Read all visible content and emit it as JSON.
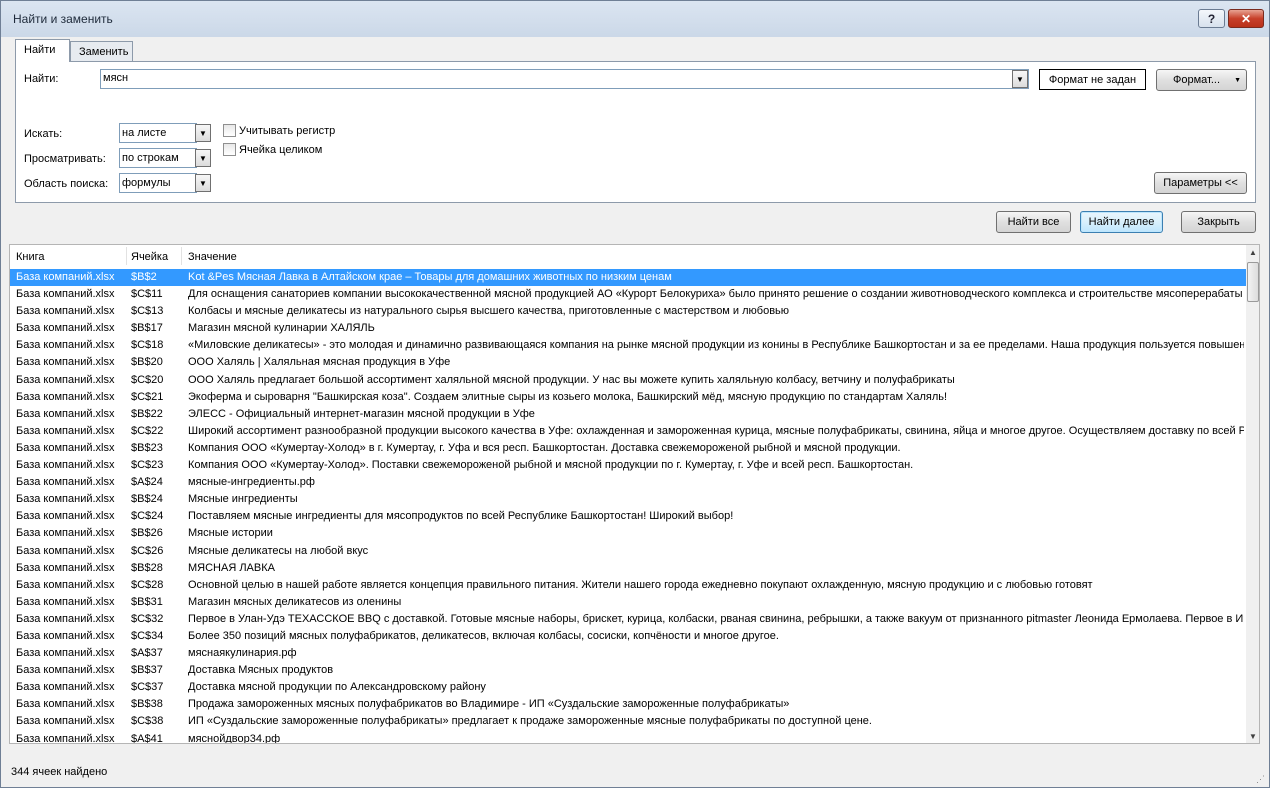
{
  "window": {
    "title": "Найти и заменить",
    "help": "?",
    "close": "✕"
  },
  "tabs": [
    {
      "label": "Найти"
    },
    {
      "label": "Заменить"
    }
  ],
  "find": {
    "label": "Найти:",
    "value": "мясн",
    "format_status": "Формат не задан",
    "format_button": "Формат...",
    "format_dropdown": "▼"
  },
  "options": {
    "within_label": "Искать:",
    "within_value": "на листе",
    "search_label": "Просматривать:",
    "search_value": "по строкам",
    "lookin_label": "Область поиска:",
    "lookin_value": "формулы",
    "match_case": "Учитывать регистр",
    "match_entire": "Ячейка целиком",
    "params_button": "Параметры <<"
  },
  "buttons": {
    "find_all": "Найти все",
    "find_next": "Найти далее",
    "close": "Закрыть"
  },
  "results": {
    "columns": [
      "Книга",
      "Ячейка",
      "Значение"
    ],
    "rows": [
      [
        "База компаний.xlsx",
        "$B$2",
        "Kot &Pes Мясная Лавка в Алтайском крае – Товары для домашних животных по низким ценам"
      ],
      [
        "База компаний.xlsx",
        "$C$11",
        "Для оснащения санаториев компании высококачественной мясной продукцией АО «Курорт Белокуриха» было принято решение о создании животноводческого комплекса и строительстве мясоперерабаты"
      ],
      [
        "База компаний.xlsx",
        "$C$13",
        "Колбасы и мясные деликатесы из натурального сырья высшего качества, приготовленные с мастерством и любовью"
      ],
      [
        "База компаний.xlsx",
        "$B$17",
        "Магазин мясной кулинарии ХАЛЯЛЬ"
      ],
      [
        "База компаний.xlsx",
        "$C$18",
        "«Миловские деликатесы» - это молодая и динамично развивающаяся компания на рынке мясной продукции из конины в Республике Башкортостан и за ее пределами. Наша продукция пользуется повышенн"
      ],
      [
        "База компаний.xlsx",
        "$B$20",
        "ООО Халяль | Халяльная мясная продукция в Уфе"
      ],
      [
        "База компаний.xlsx",
        "$C$20",
        "ООО Халяль предлагает большой ассортимент халяльной мясной продукции. У нас вы можете купить халяльную колбасу, ветчину и полуфабрикаты"
      ],
      [
        "База компаний.xlsx",
        "$C$21",
        "Экоферма и сыроварня \"Башкирская коза\". Создаем элитные сыры из козьего молока, Башкирский мёд, мясную продукцию по стандартам Халяль!"
      ],
      [
        "База компаний.xlsx",
        "$B$22",
        "ЭЛЕСС - Официальный интернет-магазин мясной продукции в Уфе"
      ],
      [
        "База компаний.xlsx",
        "$C$22",
        "Широкий ассортимент разнообразной продукции высокого качества в Уфе: охлажденная и замороженная курица, мясные полуфабрикаты, свинина, яйца и многое другое. Осуществляем доставку по всей Р"
      ],
      [
        "База компаний.xlsx",
        "$B$23",
        "Компания ООО «Кумертау-Холод» в г. Кумертау, г. Уфа и вся респ. Башкортостан. Доставка свежемороженой рыбной и мясной продукции."
      ],
      [
        "База компаний.xlsx",
        "$C$23",
        "Компания ООО «Кумертау-Холод». Поставки свежемороженой рыбной и мясной продукции по г. Кумертау, г. Уфе и всей респ. Башкортостан."
      ],
      [
        "База компаний.xlsx",
        "$A$24",
        "мясные-ингредиенты.рф"
      ],
      [
        "База компаний.xlsx",
        "$B$24",
        "Мясные ингредиенты"
      ],
      [
        "База компаний.xlsx",
        "$C$24",
        "Поставляем мясные ингредиенты для мясопродуктов по всей Республике Башкортостан! Широкий выбор!"
      ],
      [
        "База компаний.xlsx",
        "$B$26",
        "Мясные истории"
      ],
      [
        "База компаний.xlsx",
        "$C$26",
        "Мясные деликатесы на любой вкус"
      ],
      [
        "База компаний.xlsx",
        "$B$28",
        "МЯСНАЯ ЛАВКА"
      ],
      [
        "База компаний.xlsx",
        "$C$28",
        "Основной целью в нашей работе является концепция правильного питания. Жители нашего города ежедневно покупают охлажденную, мясную продукцию и с любовью готовят"
      ],
      [
        "База компаний.xlsx",
        "$B$31",
        "Магазин мясных деликатесов из оленины"
      ],
      [
        "База компаний.xlsx",
        "$C$32",
        "Первое в Улан-Удэ ТЕХАССКОЕ BBQ с доставкой. Готовые мясные наборы, брискет, курица, колбаски, рваная свинина, ребрышки, а также вакуум от признанного pitmaster Леонида Ермолаева. Первое в Ир"
      ],
      [
        "База компаний.xlsx",
        "$C$34",
        "Более 350 позиций мясных полуфабрикатов, деликатесов, включая колбасы, сосиски, копчёности и многое другое."
      ],
      [
        "База компаний.xlsx",
        "$A$37",
        "мяснаякулинария.рф"
      ],
      [
        "База компаний.xlsx",
        "$B$37",
        "Доставка Мясных продуктов"
      ],
      [
        "База компаний.xlsx",
        "$C$37",
        "Доставка мясной продукции по Александровскому району"
      ],
      [
        "База компаний.xlsx",
        "$B$38",
        "Продажа замороженных мясных полуфабрикатов во Владимире - ИП «Суздальские замороженные полуфабрикаты»"
      ],
      [
        "База компаний.xlsx",
        "$C$38",
        "ИП «Суздальские замороженные полуфабрикаты» предлагает к продаже замороженные мясные полуфабрикаты по доступной цене."
      ],
      [
        "База компаний.xlsx",
        "$A$41",
        "мяснойдвор34.рф"
      ]
    ]
  },
  "status": "344 ячеек найдено"
}
